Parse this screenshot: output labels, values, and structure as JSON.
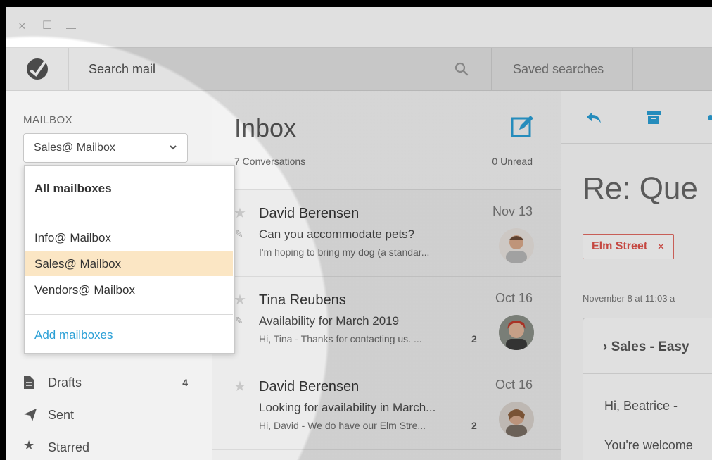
{
  "window": {
    "close": "×",
    "maximize": "☐",
    "minimize": "—"
  },
  "toolbar": {
    "search_placeholder": "Search mail",
    "saved_searches": "Saved searches"
  },
  "sidebar": {
    "mailbox_label": "MAILBOX",
    "selected_mailbox": "Sales@ Mailbox",
    "folders": [
      {
        "label": "Drafts",
        "count": "4"
      },
      {
        "label": "Sent",
        "count": ""
      },
      {
        "label": "Starred",
        "count": ""
      }
    ]
  },
  "dropdown": {
    "all": "All mailboxes",
    "items": [
      "Info@ Mailbox",
      "Sales@ Mailbox",
      "Vendors@ Mailbox"
    ],
    "add": "Add mailboxes",
    "highlight_color": "#fbe6c4",
    "link_color": "#2a9fd6"
  },
  "list": {
    "title": "Inbox",
    "conversations": "7 Conversations",
    "unread": "0 Unread",
    "messages": [
      {
        "sender": "David Berensen",
        "date": "Nov 13",
        "subject": "Can you accommodate pets?",
        "preview": "I'm hoping to bring my dog (a standar...",
        "count": "",
        "has_draft": true
      },
      {
        "sender": "Tina Reubens",
        "date": "Oct 16",
        "subject": "Availability for March 2019",
        "preview": "Hi, Tina - Thanks for contacting us. ...",
        "count": "2",
        "has_draft": true
      },
      {
        "sender": "David Berensen",
        "date": "Oct 16",
        "subject": "Looking for availability in March...",
        "preview": "Hi, David - We do have our Elm Stre...",
        "count": "2",
        "has_draft": false
      }
    ]
  },
  "detail": {
    "subject": "Re: Que",
    "tag": "Elm Street",
    "tag_remove": "×",
    "date": "November 8 at 11:03 a",
    "thread_title": "› Sales - Easy",
    "greeting": "Hi, Beatrice -",
    "body": "You're welcome",
    "accent": "#2a9fd6",
    "tag_color": "#e0514a"
  }
}
